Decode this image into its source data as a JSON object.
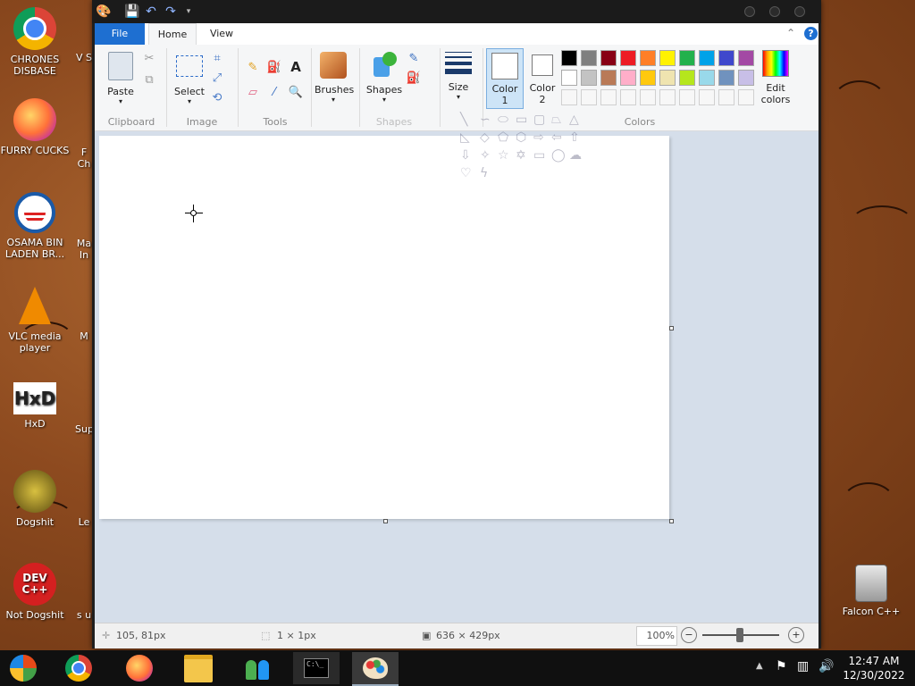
{
  "desktop": {
    "icons_left": [
      {
        "label": "CHRONES DISBASE",
        "icon": "chrome-icon"
      },
      {
        "label": "FURRY CUCKS",
        "icon": "firefox-icon"
      },
      {
        "label": "OSAMA BIN LADEN BR...",
        "icon": "obama-logo-icon"
      },
      {
        "label": "VLC media player",
        "icon": "vlc-icon"
      },
      {
        "label": "HxD",
        "icon": "hxd-icon"
      },
      {
        "label": "Dogshit",
        "icon": "dogshit-icon"
      },
      {
        "label": "Not Dogshit",
        "icon": "devcpp-icon"
      }
    ],
    "icons_partial": [
      {
        "label": "V S"
      },
      {
        "label": "F Ch"
      },
      {
        "label": "Ma In"
      },
      {
        "label": "M"
      },
      {
        "label": "Sup"
      },
      {
        "label": "Le"
      },
      {
        "label": "s u"
      }
    ],
    "recycle_bin_label": "Falcon C++"
  },
  "paint": {
    "tabs": {
      "file": "File",
      "home": "Home",
      "view": "View"
    },
    "clipboard": {
      "paste": "Paste",
      "label": "Clipboard"
    },
    "image": {
      "select": "Select",
      "label": "Image"
    },
    "tools": {
      "label": "Tools"
    },
    "brushes": {
      "label": "Brushes"
    },
    "shapes": {
      "button": "Shapes",
      "label": "Shapes"
    },
    "size": {
      "label": "Size"
    },
    "color1": {
      "line1": "Color",
      "line2": "1"
    },
    "color2": {
      "line1": "Color",
      "line2": "2"
    },
    "colors": {
      "label": "Colors",
      "edit_line1": "Edit",
      "edit_line2": "colors"
    },
    "palette_row1": [
      "#000000",
      "#7f7f7f",
      "#880015",
      "#ed1c24",
      "#ff7f27",
      "#fff200",
      "#22b14c",
      "#00a2e8",
      "#3f48cc",
      "#a349a4"
    ],
    "palette_row2": [
      "#ffffff",
      "#c3c3c3",
      "#b97a57",
      "#ffaec9",
      "#ffc90e",
      "#efe4b0",
      "#b5e61d",
      "#99d9ea",
      "#7092be",
      "#c8bfe7"
    ],
    "status": {
      "cursor_pos": "105, 81px",
      "selection_size": "1 × 1px",
      "image_size": "636 × 429px",
      "zoom": "100%"
    }
  },
  "taskbar": {
    "time": "12:47 AM",
    "date": "12/30/2022"
  }
}
